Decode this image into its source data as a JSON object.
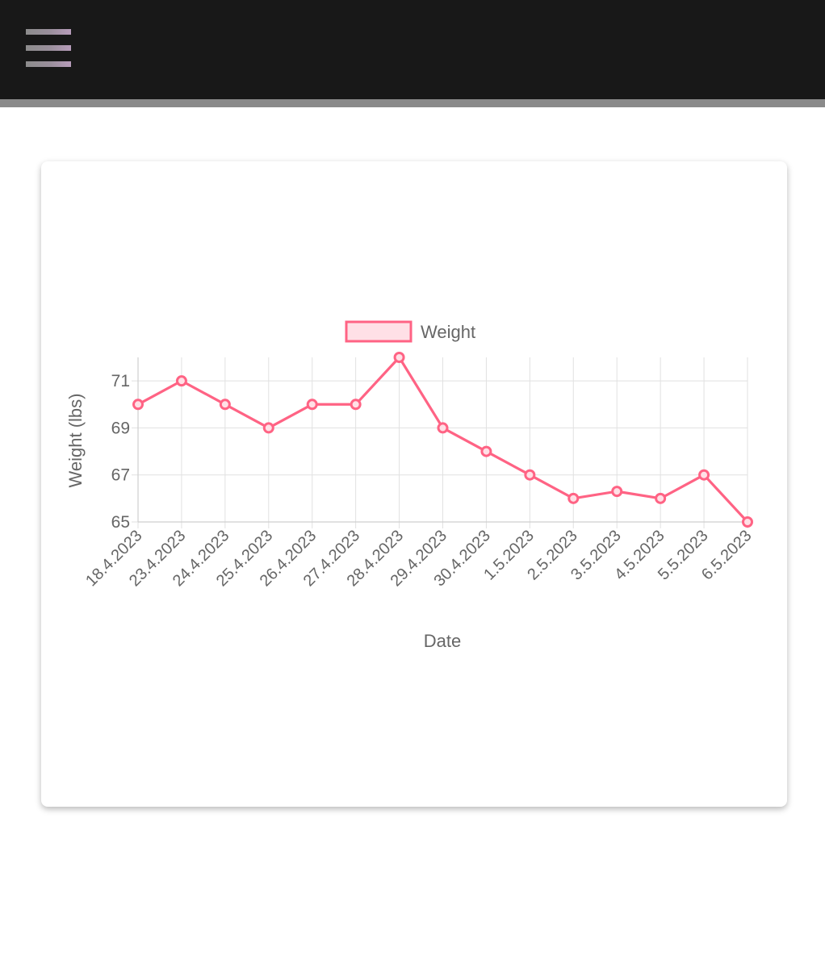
{
  "header": {
    "menu_icon": "hamburger-menu-icon",
    "background_color": "#181818",
    "rule_color": "#8a8a8a"
  },
  "chart_data": {
    "type": "line",
    "title": "",
    "xlabel": "Date",
    "ylabel": "Weight (lbs)",
    "categories": [
      "18.4.2023",
      "23.4.2023",
      "24.4.2023",
      "25.4.2023",
      "26.4.2023",
      "27.4.2023",
      "28.4.2023",
      "29.4.2023",
      "30.4.2023",
      "1.5.2023",
      "2.5.2023",
      "3.5.2023",
      "4.5.2023",
      "5.5.2023",
      "6.5.2023"
    ],
    "series": [
      {
        "name": "Weight",
        "values": [
          70,
          71,
          70,
          69,
          70,
          70,
          72,
          69,
          68,
          67,
          66,
          66.3,
          66,
          67,
          65
        ],
        "color": "#ff6384",
        "fill_color": "#ffe0e6"
      }
    ],
    "yticks": [
      65,
      67,
      69,
      71
    ],
    "ylim": [
      65,
      72
    ],
    "grid": true,
    "legend_position": "top",
    "tick_rotation_deg": -45
  }
}
